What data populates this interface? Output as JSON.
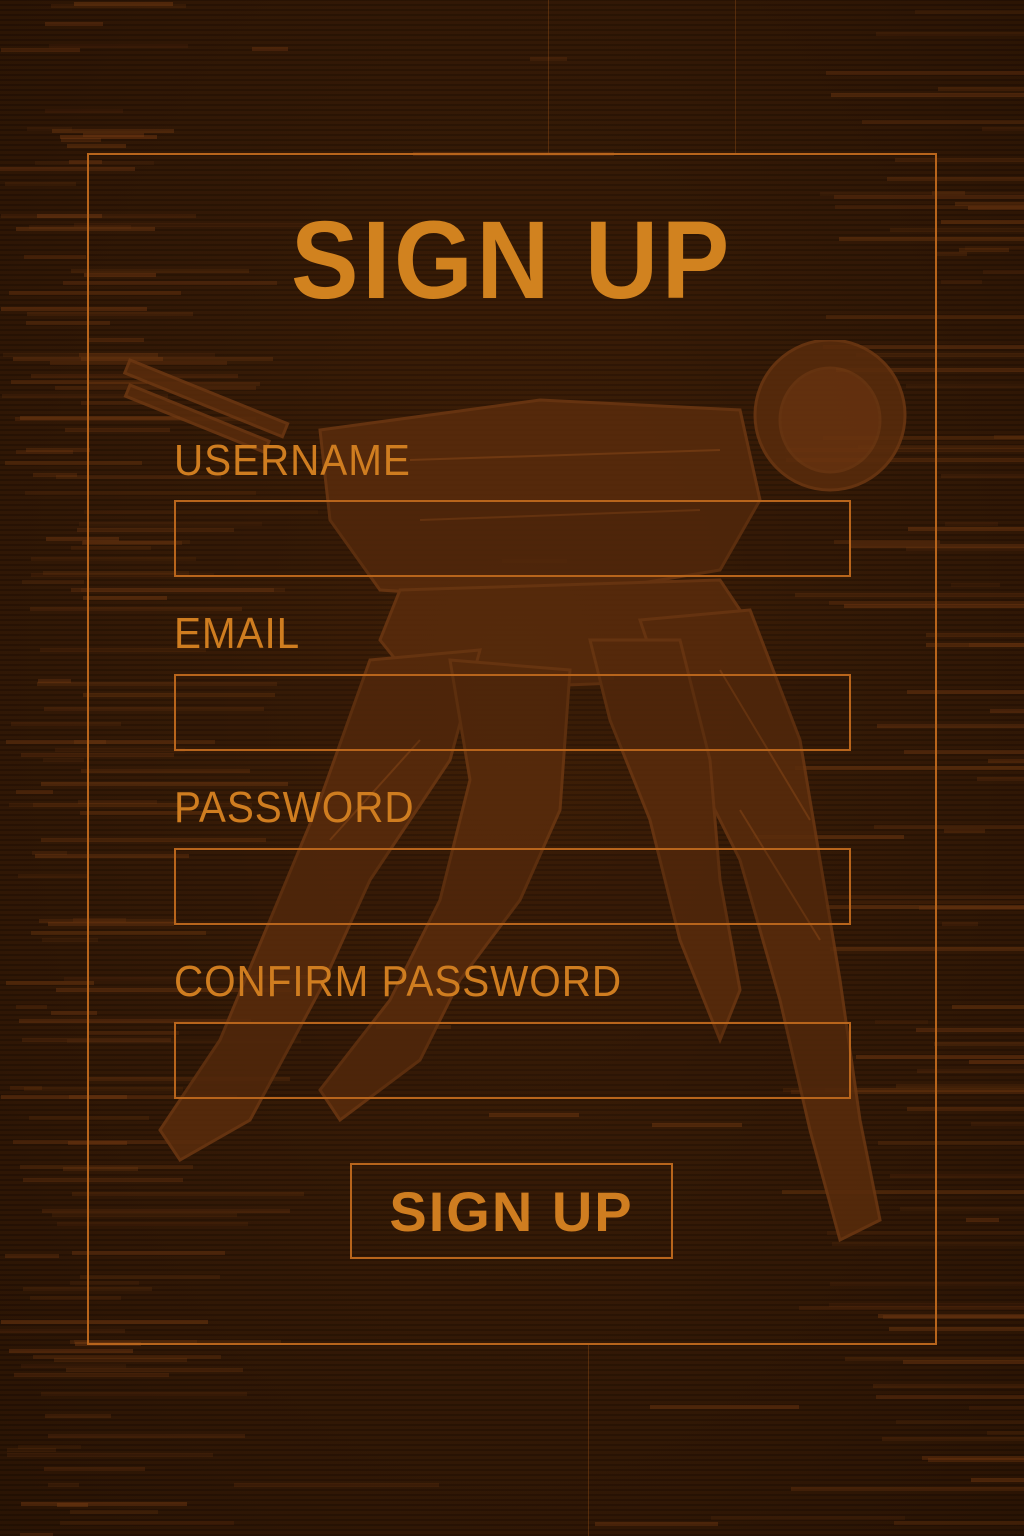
{
  "form": {
    "title": "SIGN UP",
    "fields": [
      {
        "label": "USERNAME",
        "value": ""
      },
      {
        "label": "EMAIL",
        "value": ""
      },
      {
        "label": "PASSWORD",
        "value": ""
      },
      {
        "label": "CONFIRM PASSWORD",
        "value": ""
      }
    ],
    "submit_label": "SIGN UP"
  },
  "colors": {
    "background": "#2d1504",
    "accent": "#cf7d20",
    "border": "#b8651c"
  },
  "icons": {
    "background_art": "mech-robot-illustration"
  }
}
